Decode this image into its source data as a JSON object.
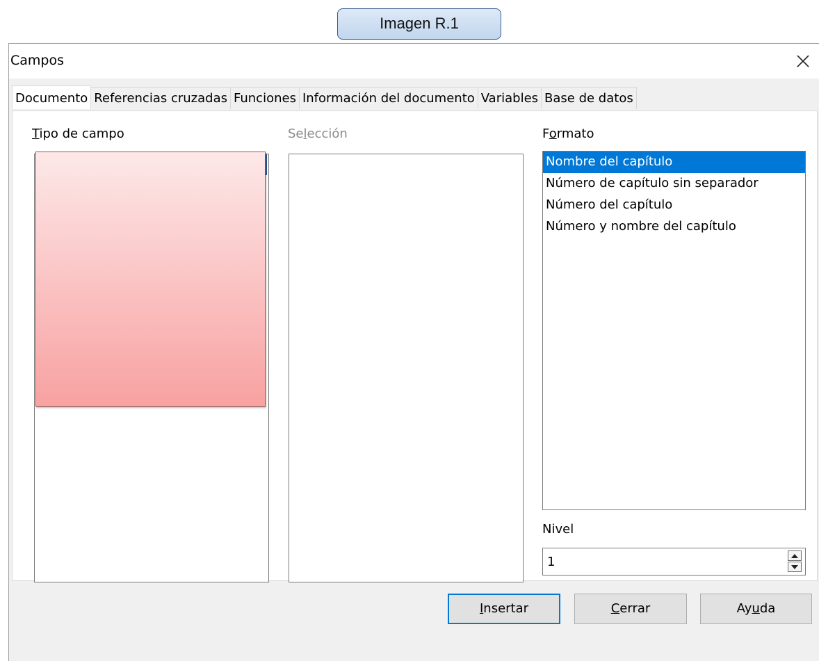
{
  "caption": "Imagen R.1",
  "window": {
    "title": "Campos",
    "close_glyph": "✕"
  },
  "tabs": [
    {
      "label": "Documento",
      "active": true
    },
    {
      "label": "Referencias cruzadas",
      "active": false
    },
    {
      "label": "Funciones",
      "active": false
    },
    {
      "label": "Información del documento",
      "active": false
    },
    {
      "label": "Variables",
      "active": false
    },
    {
      "label": "Base de datos",
      "active": false
    }
  ],
  "tipo_campo": {
    "label_mnemonic": "T",
    "label_rest": "ipo de campo",
    "items": []
  },
  "seleccion": {
    "label_pre": "Se",
    "label_mnemonic": "l",
    "label_rest": "ección",
    "items": []
  },
  "formato": {
    "label_pre": "F",
    "label_mnemonic": "o",
    "label_rest": "rmato",
    "items": [
      "Nombre del capítulo",
      "Número de capítulo sin separador",
      "Número del capítulo",
      "Número y nombre del capítulo"
    ],
    "selected_index": 0
  },
  "nivel": {
    "label": "Nivel",
    "value": "1"
  },
  "buttons": {
    "insertar": {
      "mnemonic": "I",
      "rest": "nsertar"
    },
    "cerrar": {
      "mnemonic": "C",
      "rest": "errar"
    },
    "ayuda": {
      "pre": "Ay",
      "mnemonic": "u",
      "rest": "da"
    }
  },
  "colors": {
    "selection": "#0078d7",
    "redaction_top": "#fde8e8",
    "redaction_bottom": "#f8a1a1"
  }
}
